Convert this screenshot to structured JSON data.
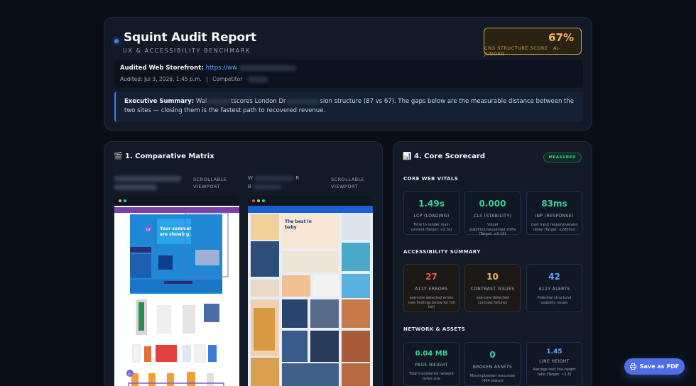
{
  "header": {
    "title": "Squint Audit Report",
    "subtitle": "UX & ACCESSIBILITY BENCHMARK",
    "score_value": "67%",
    "score_label": "CRO STRUCTURE SCORE",
    "score_sub": "· AI-JUDGED",
    "storefront_label": "Audited Web Storefront:",
    "storefront_link": "https://ww",
    "audited": "Audited: Jul 3, 2026, 1:45 p.m.",
    "sep": "|",
    "competitor": "Competitor",
    "exec_label": "Executive Summary:",
    "exec_p1": "Wal",
    "exec_p2": "tscores London Dr",
    "exec_p3": "sion structure (87 vs 67). The gaps below are the measurable distance between the two sites — closing them is the fastest path to recovered revenue."
  },
  "matrix": {
    "title": "1. Comparative Matrix",
    "title_icon": "clapper-icon",
    "col1_label": "SCROLLABLE VIEWPORT",
    "col2_prefix": "W",
    "col2_suffix": "R",
    "col2_line2": "B",
    "col2_label": "SCROLLABLE VIEWPORT"
  },
  "scorecard": {
    "title": "4. Core Scorecard",
    "title_icon": "chart-icon",
    "badge": "MEASURED",
    "groups": {
      "vitals": "CORE WEB VITALS",
      "a11y": "ACCESSIBILITY SUMMARY",
      "network": "NETWORK & ASSETS"
    },
    "vitals": [
      {
        "value": "1.49s",
        "label": "LCP (LOADING)",
        "desc": "Time to render main content (Target: ≤2.5s)"
      },
      {
        "value": "0.000",
        "label": "CLS (STABILITY)",
        "desc": "Visual stability/unexpected shifts (Target: ≤0.10)"
      },
      {
        "value": "83ms",
        "label": "INP (RESPONSE)",
        "desc": "User input responsiveness delay (Target: ≤200ms)"
      }
    ],
    "a11y": [
      {
        "value": "27",
        "label": "A11Y ERRORS",
        "desc": "axe-core detected errors (see findings below for full list)"
      },
      {
        "value": "10",
        "label": "CONTRAST ISSUES",
        "desc": "axe-core detected contrast failures"
      },
      {
        "value": "42",
        "label": "A11Y ALERTS",
        "desc": "Potential structural usability issues"
      }
    ],
    "network": [
      {
        "value": "0.04 MB",
        "label": "PAGE WEIGHT",
        "desc": "Total transferred network bytes size"
      },
      {
        "value": "0",
        "label": "BROKEN ASSETS",
        "desc": "Missing/broken resources (404 status)"
      },
      {
        "value": "1.45",
        "label": "LINE HEIGHT",
        "desc": "Average text line-height ratio (Target: ~1.5)"
      }
    ]
  },
  "pdf_button": "Save as PDF",
  "colors": {
    "green": "#34d399",
    "red": "#f05252",
    "amber": "#f0b45a",
    "blue": "#60a5fa",
    "accent": "#4f6ee8"
  }
}
